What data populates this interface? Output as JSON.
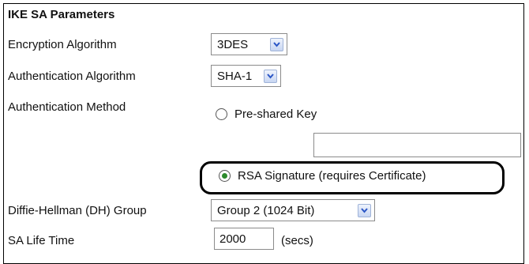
{
  "section": {
    "title": "IKE SA Parameters"
  },
  "encryption": {
    "label": "Encryption Algorithm",
    "value": "3DES"
  },
  "authentication_algorithm": {
    "label": "Authentication Algorithm",
    "value": "SHA-1"
  },
  "authentication_method": {
    "label": "Authentication Method",
    "options": [
      {
        "label": "Pre-shared Key",
        "selected": false
      },
      {
        "label": "RSA Signature (requires Certificate)",
        "selected": true
      }
    ],
    "preshared_key_value": ""
  },
  "dh_group": {
    "label": "Diffie-Hellman (DH) Group",
    "value": "Group 2 (1024 Bit)"
  },
  "sa_lifetime": {
    "label": "SA Life Time",
    "value": "2000",
    "unit": "(secs)"
  },
  "icons": {
    "dropdown": "chevron-down-icon",
    "radio": "radio-button-icon"
  },
  "colors": {
    "dropdown_arrow": "#2a56c6",
    "radio_selected": "#2b8a2b",
    "highlight_border": "#000000"
  }
}
